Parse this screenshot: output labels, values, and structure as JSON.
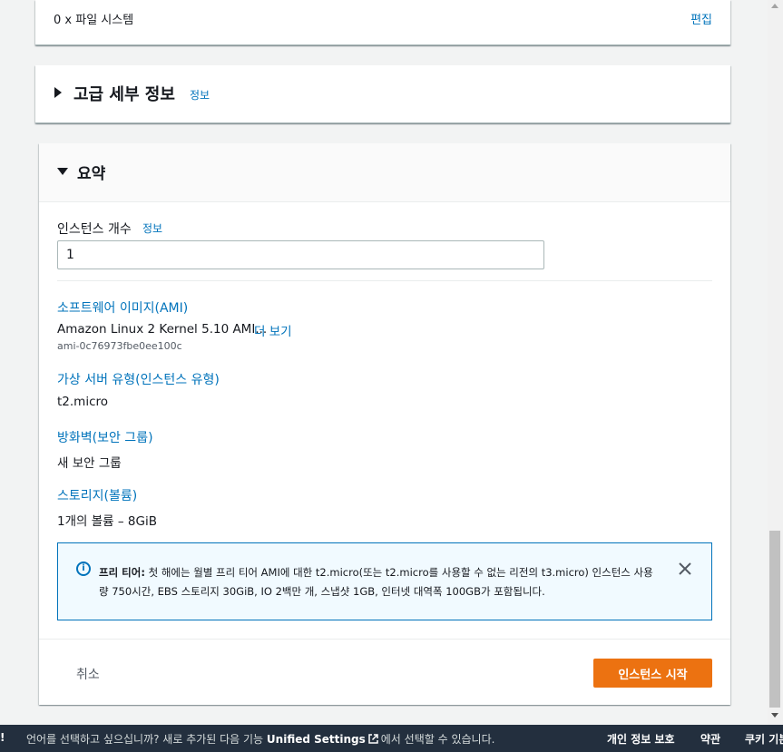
{
  "storage": {
    "file_systems": "0 x 파일 시스템",
    "edit": "편집"
  },
  "advanced": {
    "title": "고급 세부 정보",
    "info": "정보"
  },
  "summary": {
    "title": "요약",
    "instance_count_label": "인스턴스 개수",
    "instance_count_info": "정보",
    "instance_count_value": "1",
    "ami_label": "소프트웨어 이미지(AMI)",
    "ami_value": "Amazon Linux 2 Kernel 5.10 AMI...",
    "ami_more": "더 보기",
    "ami_id": "ami-0c76973fbe0ee100c",
    "type_label": "가상 서버 유형(인스턴스 유형)",
    "type_value": "t2.micro",
    "firewall_label": "방화벽(보안 그룹)",
    "firewall_value": "새 보안 그룹",
    "storage_label": "스토리지(볼륨)",
    "storage_value": "1개의 볼륨 – 8GiB",
    "alert_bold": "프리 티어:",
    "alert_text": " 첫 해에는 월별 프리 티어 AMI에 대한 t2.micro(또는 t2.micro를 사용할 수 없는 리전의 t3.micro) 인스턴스 사용량 750시간, EBS 스토리지 30GiB, IO 2백만 개, 스냅샷 1GB, 인터넷 대역폭 100GB가 포함됩니다.",
    "cancel": "취소",
    "launch": "인스턴스 시작"
  },
  "footer": {
    "edge_text": "!",
    "msg_before": "언어를 선택하고 싶으십니까? 새로 추가된 다음 기능 ",
    "msg_bold": "Unified Settings",
    "msg_after": "에서 선택할 수 있습니다.",
    "privacy": "개인 정보 보호",
    "terms": "약관",
    "cookie": "쿠키 기본"
  },
  "colors": {
    "link": "#0073bb",
    "primary_button": "#ec7211",
    "footer_bg": "#232f3e",
    "alert_bg": "#f1faff"
  }
}
